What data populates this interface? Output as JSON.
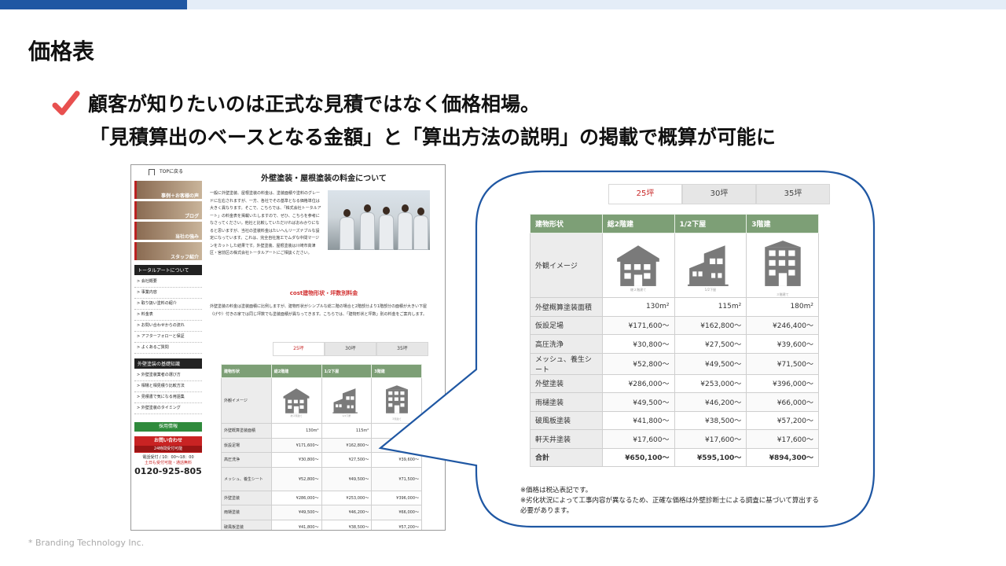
{
  "slide": {
    "title": "価格表",
    "headline_line1": "顧客が知りたいのは正式な見積ではなく価格相場。",
    "headline_line2": "「見積算出のベースとなる金額」と「算出方法の説明」の掲載で概算が可能に",
    "copyright": "* Branding Technology Inc."
  },
  "site": {
    "top_link": "TOPに戻る",
    "banners": [
      "事例＋お客様の声",
      "ブログ",
      "当社の強み",
      "スタッフ紹介"
    ],
    "about_heading": "トータルアートについて",
    "about_items": [
      "> 会社概要",
      "> 事業内容",
      "> 取り扱い塗料の紹介",
      "> 料金表",
      "> お問い合わせからの流れ",
      "> アフターフォローと保証",
      "> よくあるご質問"
    ],
    "basics_heading": "外壁塗装の基礎知識",
    "basics_items": [
      "> 外壁塗装業者の選び方",
      "> 相場と相見積り比較方法",
      "> 見積書で気になる用語集",
      "> 外壁塗装のタイミング"
    ],
    "recruit": "採用情報",
    "contact": "お問い合わせ",
    "contact_sub": "24時間受付可能",
    "hours": "電話受付 / 10：00～18：00",
    "holiday": "土日も受付可能・通話無料",
    "phone": "0120-925-805",
    "main_title": "外壁塗装・屋根塗装の料金について",
    "intro": "一般に外壁塗装、屋根塗装の料金は、塗装面積や塗料のグレードに左右されますが、一方、各社でその基準となる価格単位は大きく異なります。そこで、こちらでは、「株式会社トータルアート」の料金表を掲載いたしますので、ぜひ、こちらを参考になさってください。他社と比較していただければおわかりになると思いますが、当社の塗装料金はたいへんリーズナブルな設定になっています。これは、完全自社施工でムダな中間マージンをカットした結果です。外壁塗装、屋根塗装は川崎市高津区・宮前区の株式会社トータルアートにご相談ください。",
    "subheading": "cost建物形状・坪数別料金",
    "explain": "外壁塗装の料金は塗装面積に比例しますが、建物形状がシンプルな総二階の場合と2階部分より1階部分の面積が大きい下屋（げや）付きの家では同じ坪数でも塗装面積が異なってきます。こちらでは、「建物形状と坪数」別の料金をご案内します。"
  },
  "price_table": {
    "tabs": [
      "25坪",
      "30坪",
      "35坪"
    ],
    "active_tab": "25坪",
    "headers": [
      "建物形状",
      "総2階建",
      "1/2下屋",
      "3階建"
    ],
    "image_row_label": "外観イメージ",
    "image_icons": [
      "two-story-house-icon",
      "half-annex-house-icon",
      "three-story-building-icon"
    ],
    "image_captions": [
      "総２階建て",
      "1/2下屋",
      "３階建て"
    ],
    "rows": [
      {
        "label": "外壁概算塗装面積",
        "values": [
          "130m²",
          "115m²",
          "180m²"
        ]
      },
      {
        "label": "仮設足場",
        "values": [
          "¥171,600～",
          "¥162,800～",
          "¥246,400～"
        ]
      },
      {
        "label": "高圧洗浄",
        "values": [
          "¥30,800～",
          "¥27,500～",
          "¥39,600～"
        ]
      },
      {
        "label": "メッシュ、養生シート",
        "values": [
          "¥52,800～",
          "¥49,500～",
          "¥71,500～"
        ]
      },
      {
        "label": "外壁塗装",
        "values": [
          "¥286,000～",
          "¥253,000～",
          "¥396,000～"
        ]
      },
      {
        "label": "雨樋塗装",
        "values": [
          "¥49,500～",
          "¥46,200～",
          "¥66,000～"
        ]
      },
      {
        "label": "破風板塗装",
        "values": [
          "¥41,800～",
          "¥38,500～",
          "¥57,200～"
        ]
      },
      {
        "label": "軒天井塗装",
        "values": [
          "¥17,600～",
          "¥17,600～",
          "¥17,600～"
        ]
      }
    ],
    "total": {
      "label": "合計",
      "values": [
        "¥650,100～",
        "¥595,100～",
        "¥894,300～"
      ]
    },
    "notes": [
      "※価格は税込表記です。",
      "※劣化状況によって工事内容が異なるため、正確な価格は外壁診断士による調査に基づいて算出する",
      "必要があります。"
    ]
  },
  "colors": {
    "brand_blue": "#1f57a3",
    "table_header_green": "#7d9f76",
    "active_tab_red": "#c82828",
    "check_red": "#e8504f"
  }
}
